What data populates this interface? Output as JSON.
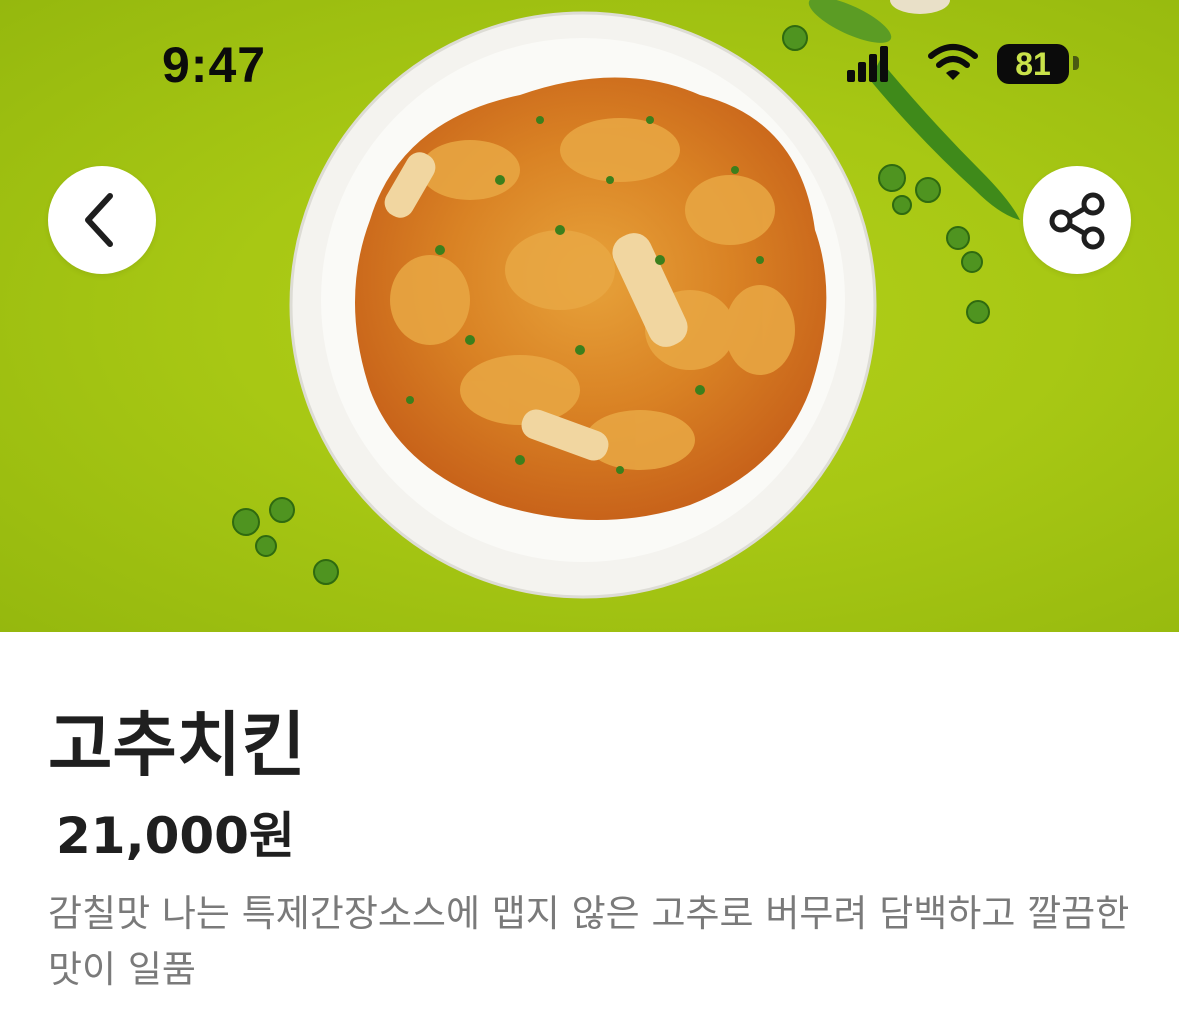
{
  "status_bar": {
    "time": "9:47",
    "battery": "81",
    "icons": [
      "cellular-signal-icon",
      "wifi-icon",
      "battery-icon"
    ]
  },
  "hero": {
    "image": "spicy-pepper-chicken-plate-photo",
    "background_color": "#a8c814",
    "back_icon": "chevron-left-icon",
    "share_icon": "share-icon"
  },
  "product": {
    "name": "고추치킨",
    "price": "21,000원",
    "description": "감칠맛 나는 특제간장소스에 맵지 않은 고추로 버무려 담백하고 깔끔한 맛이 일품"
  }
}
